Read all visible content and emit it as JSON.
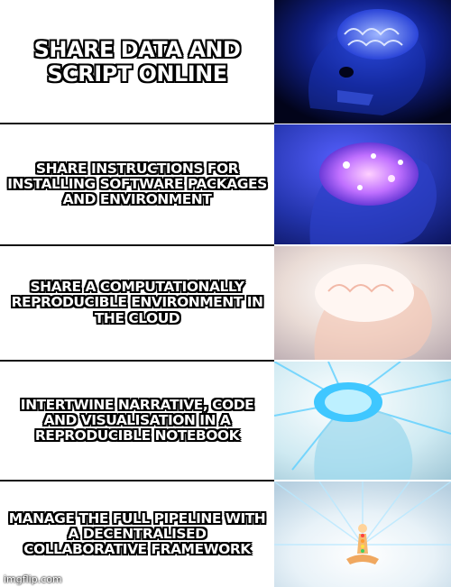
{
  "panels": [
    {
      "caption": "SHARE DATA AND SCRIPT ONLINE"
    },
    {
      "caption": "SHARE INSTRUCTIONS FOR INSTALLING SOFTWARE PACKAGES AND ENVIRONMENT"
    },
    {
      "caption": "SHARE A COMPUTATIONALLY REPRODUCIBLE ENVIRONMENT IN THE CLOUD"
    },
    {
      "caption": "INTERTWINE NARRATIVE, CODE AND VISUALISATION IN A REPRODUCIBLE NOTEBOOK"
    },
    {
      "caption": "MANAGE THE FULL PIPELINE WITH A DECENTRALISED COLLABORATIVE FRAMEWORK"
    }
  ],
  "watermark": "imgflip.com",
  "colors": {
    "caption_text": "#ffffff",
    "caption_outline": "#000000",
    "panel1_bg": "#05082a",
    "panel2_bg": "#1a2a8a",
    "panel3_bg": "#d9c6c0",
    "panel4_bg": "#cfe9f0",
    "panel5_bg": "#eaf2f7"
  },
  "icons": [
    "brain-skull-blue",
    "brain-glowing-purple",
    "brain-white-light",
    "brain-radiant-cyan",
    "meditating-figure-light"
  ]
}
